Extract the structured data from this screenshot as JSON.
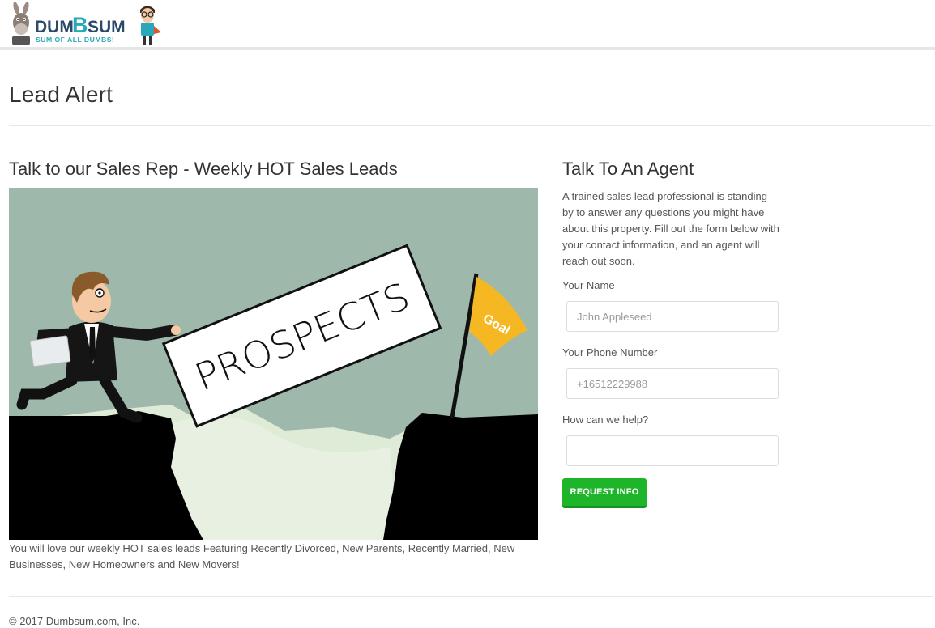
{
  "header": {
    "logo": {
      "name_part1": "DUM",
      "name_part2": "B",
      "name_part3": "SUM",
      "tagline": "SUM OF ALL DUMBS!",
      "icons": [
        "donkey-mascot-icon",
        "nerd-mascot-icon"
      ],
      "colors": {
        "dark": "#2b4a6b",
        "accent": "#2aa7b8"
      }
    }
  },
  "page": {
    "title": "Lead Alert"
  },
  "main": {
    "heading": "Talk to our Sales Rep - Weekly HOT Sales Leads",
    "illustration": {
      "sign_text": "PROSPECTS",
      "flag_text": "Goal",
      "colors": {
        "sky": "#9fb8ac",
        "cliff": "#000000",
        "valley": "#deebd7",
        "flag": "#f5b823"
      }
    },
    "caption": "You will love our weekly HOT sales leads Featuring Recently Divorced, New Parents, Recently Married, New Businesses, New Homeowners and New Movers!"
  },
  "agent_form": {
    "heading": "Talk To An Agent",
    "description": "A trained sales lead professional is standing by to answer any questions you might have about this property. Fill out the form below with your contact information, and an agent will reach out soon.",
    "name_label": "Your Name",
    "name_placeholder": "John Appleseed",
    "phone_label": "Your Phone Number",
    "phone_placeholder": "+16512229988",
    "help_label": "How can we help?",
    "help_value": "",
    "submit_label": "REQUEST INFO",
    "submit_color": "#1fb52a"
  },
  "footer": {
    "copyright": "© 2017 Dumbsum.com, Inc."
  }
}
